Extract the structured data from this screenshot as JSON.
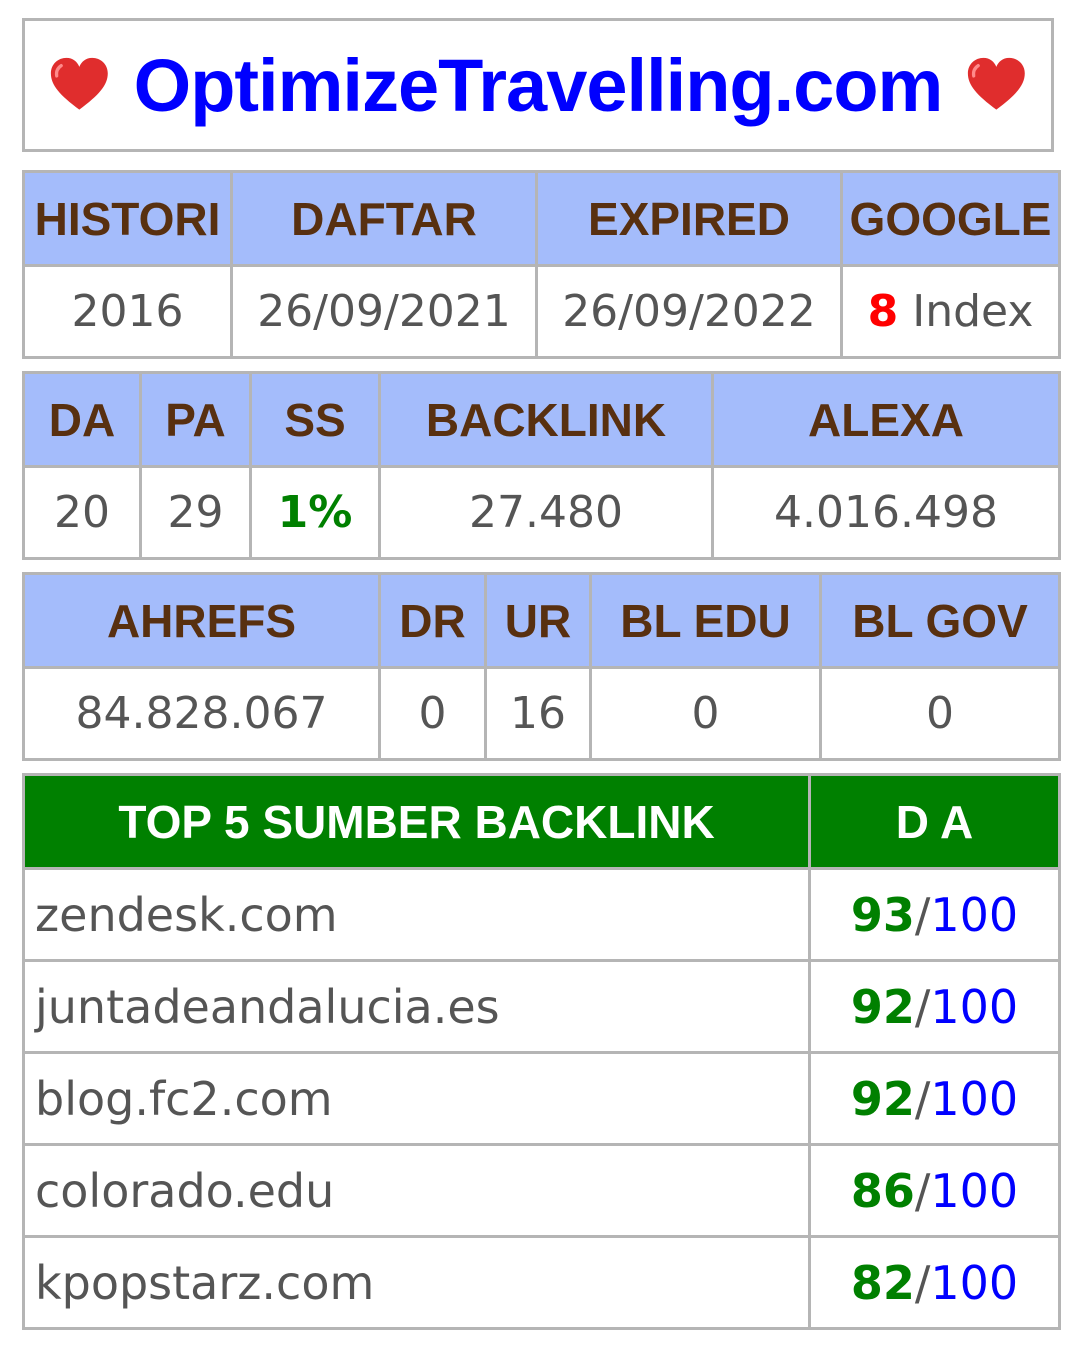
{
  "site": {
    "title": "OptimizeTravelling.com",
    "heart_icon": "heart-icon"
  },
  "table1": {
    "headers": [
      "HISTORI",
      "DAFTAR",
      "EXPIRED",
      "GOOGLE"
    ],
    "histori": "2016",
    "daftar": "26/09/2021",
    "expired": "26/09/2022",
    "google_count": "8",
    "google_label": "Index"
  },
  "table2": {
    "headers": [
      "DA",
      "PA",
      "SS",
      "BACKLINK",
      "ALEXA"
    ],
    "da": "20",
    "pa": "29",
    "ss": "1%",
    "backlink": "27.480",
    "alexa": "4.016.498"
  },
  "table3": {
    "headers": [
      "AHREFS",
      "DR",
      "UR",
      "BL EDU",
      "BL GOV"
    ],
    "ahrefs": "84.828.067",
    "dr": "0",
    "ur": "16",
    "bl_edu": "0",
    "bl_gov": "0"
  },
  "table4": {
    "headers": [
      "TOP 5 SUMBER BACKLINK",
      "D A"
    ],
    "rows": [
      {
        "domain": "zendesk.com",
        "score": "93",
        "max": "100"
      },
      {
        "domain": "juntadeandalucia.es",
        "score": "92",
        "max": "100"
      },
      {
        "domain": "blog.fc2.com",
        "score": "92",
        "max": "100"
      },
      {
        "domain": "colorado.edu",
        "score": "86",
        "max": "100"
      },
      {
        "domain": "kpopstarz.com",
        "score": "82",
        "max": "100"
      }
    ]
  },
  "colors": {
    "header_blue": "#a4bcfb",
    "header_text": "#583010",
    "header_green": "#008000",
    "title_blue": "#0000ff",
    "index_red": "#ff0000"
  }
}
